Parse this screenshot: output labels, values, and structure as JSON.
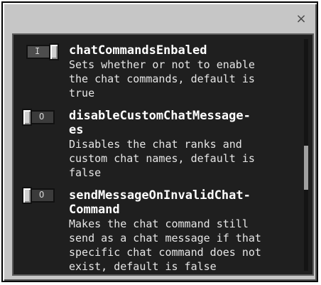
{
  "dialog": {
    "close_glyph": "×"
  },
  "settings": [
    {
      "state": "on",
      "toggle_glyph": "I",
      "title": "chatCommandsEnbaled",
      "description": "Sets whether or not to enable\nthe chat commands, default is\ntrue"
    },
    {
      "state": "off",
      "toggle_glyph": "O",
      "title": "disableCustomChatMessage-\nes",
      "description": "Disables the chat ranks and\ncustom chat names, default is\nfalse"
    },
    {
      "state": "off",
      "toggle_glyph": "O",
      "title": "sendMessageOnInvalidChat-\nCommand",
      "description": "Makes the chat command still\nsend as a chat message if that\nspecific chat command does not\nexist, default is false"
    }
  ]
}
